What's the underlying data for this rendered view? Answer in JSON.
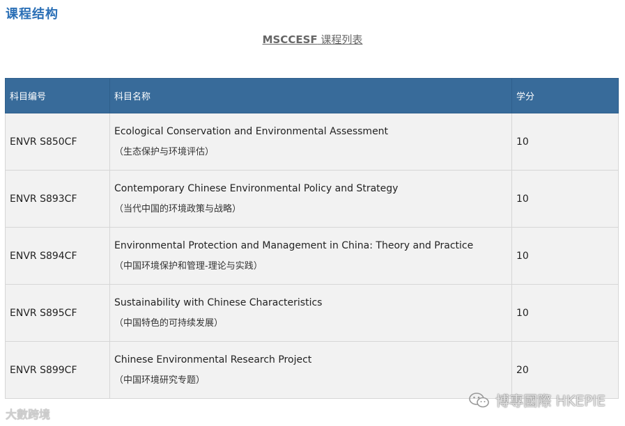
{
  "section_title": "课程结构",
  "caption": {
    "code": "MSCCESF",
    "rest": " 课程列表"
  },
  "table": {
    "headers": {
      "code": "科目编号",
      "name": "科目名称",
      "credits": "学分"
    },
    "rows": [
      {
        "code": "ENVR S850CF",
        "name_en": "Ecological Conservation and Environmental Assessment",
        "name_zh": "（生态保护与环境评估）",
        "credits": "10"
      },
      {
        "code": "ENVR S893CF",
        "name_en": "Contemporary Chinese Environmental Policy and Strategy",
        "name_zh": "（当代中国的环境政策与战略）",
        "credits": "10"
      },
      {
        "code": "ENVR S894CF",
        "name_en": "Environmental Protection and Management in China: Theory and Practice",
        "name_zh": "（中国环境保护和管理-理论与实践）",
        "credits": "10"
      },
      {
        "code": "ENVR S895CF",
        "name_en": "Sustainability with Chinese Characteristics",
        "name_zh": "（中国特色的可持续发展）",
        "credits": "10"
      },
      {
        "code": "ENVR S899CF",
        "name_en": "Chinese Environmental Research Project",
        "name_zh": "（中国环境研究专题）",
        "credits": "20"
      }
    ]
  },
  "watermarks": {
    "left": "大數跨境",
    "right": "博專國際 HKEPIE"
  },
  "colors": {
    "header_bg": "#386b9a",
    "title": "#2a6fb6",
    "cell_bg": "#f2f2f2"
  }
}
